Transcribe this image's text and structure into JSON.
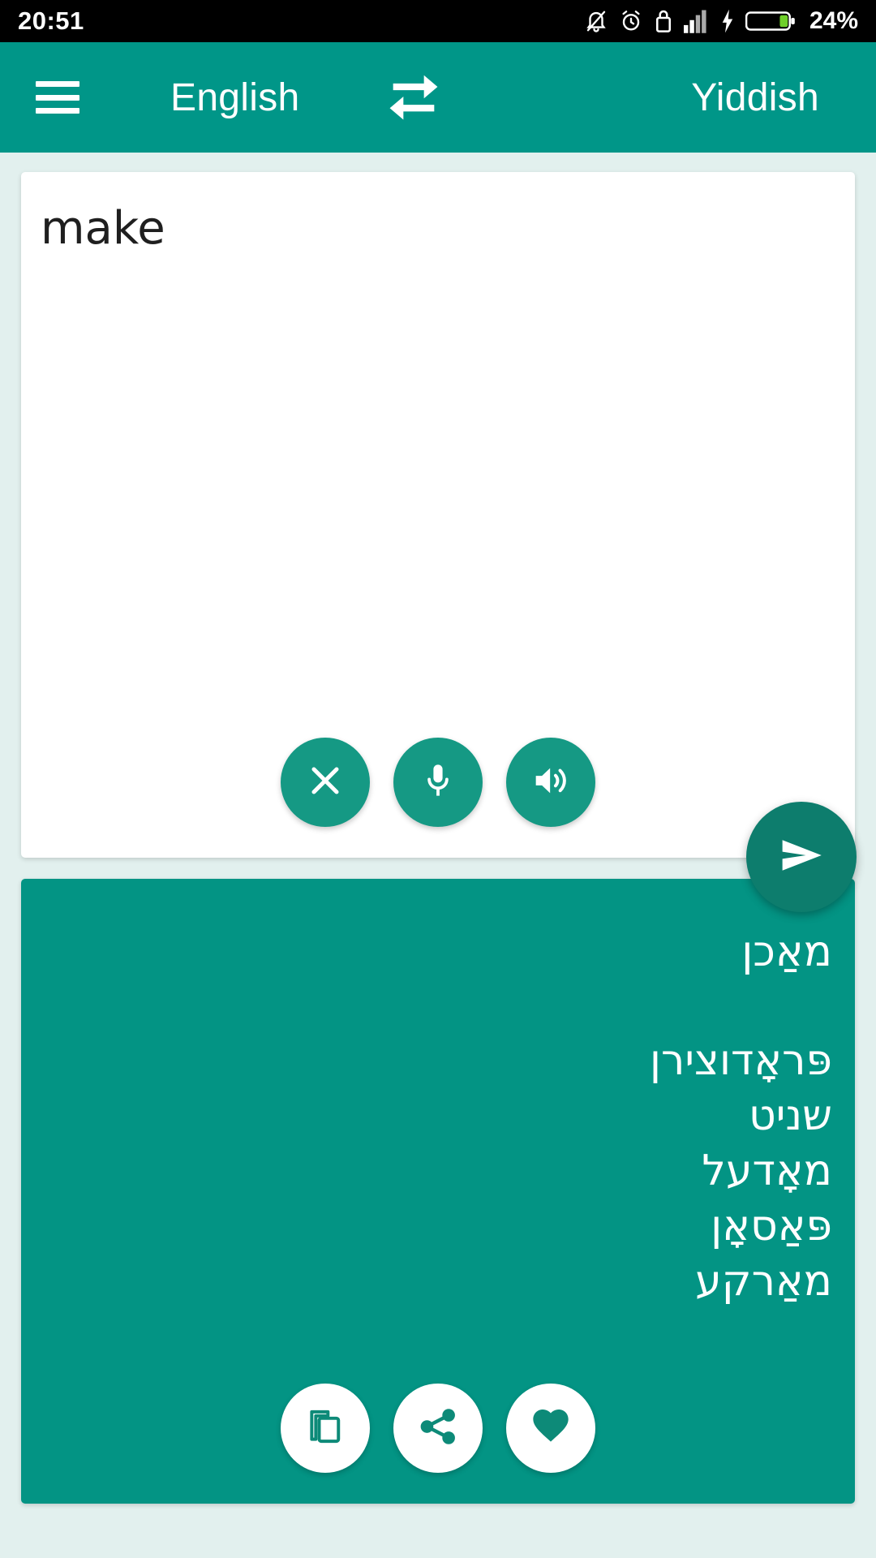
{
  "status_bar": {
    "time": "20:51",
    "battery_percent": "24%",
    "icons": [
      "notifications-off-icon",
      "alarm-icon",
      "lock-icon",
      "signal-bars-icon",
      "charging-bolt-icon",
      "battery-icon"
    ]
  },
  "app_bar": {
    "menu_icon": "hamburger-menu-icon",
    "source_language": "English",
    "swap_icon": "swap-languages-icon",
    "target_language": "Yiddish"
  },
  "input_card": {
    "text": "make",
    "placeholder": "",
    "actions": [
      {
        "name": "clear-button",
        "icon": "close-icon"
      },
      {
        "name": "microphone-button",
        "icon": "microphone-icon"
      },
      {
        "name": "speak-source-button",
        "icon": "volume-up-icon"
      }
    ]
  },
  "send_button": {
    "name": "translate-send-button",
    "icon": "send-icon"
  },
  "output_card": {
    "translation": "מאַכן",
    "synonyms": [
      "פּראָדוצירן",
      "שניט",
      "מאָדעל",
      "פּאַסאָן",
      "מאַרקע"
    ],
    "actions": [
      {
        "name": "copy-button",
        "icon": "copy-icon"
      },
      {
        "name": "share-button",
        "icon": "share-icon"
      },
      {
        "name": "favorite-button",
        "icon": "heart-icon"
      }
    ]
  },
  "colors": {
    "primary": "#009688",
    "output_card": "#039484",
    "fab": "#0d7d6d",
    "background": "#e2f0ee",
    "status_bar": "#000000",
    "battery_green": "#6fcf2a"
  }
}
